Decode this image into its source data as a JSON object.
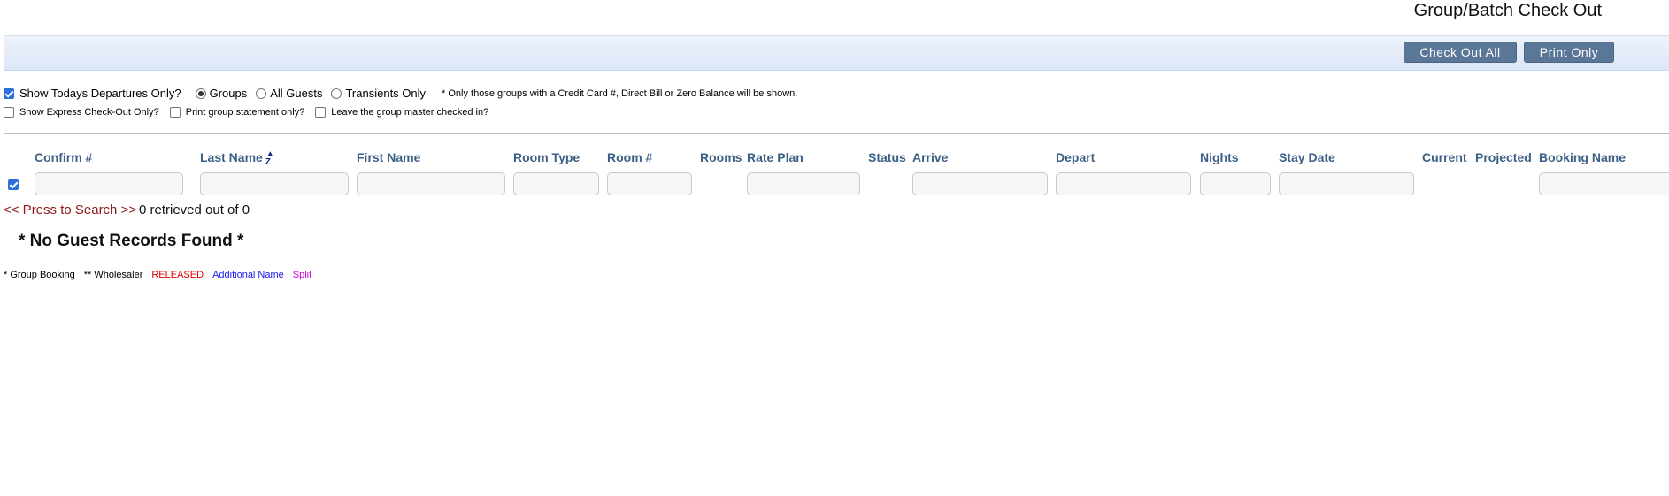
{
  "page": {
    "title": "Group/Batch Check Out"
  },
  "toolbar": {
    "check_out_all": "Check Out All",
    "print_only": "Print Only"
  },
  "options": {
    "todays_departures": {
      "label": "Show Todays Departures Only?",
      "checked": true
    },
    "radio": {
      "groups": "Groups",
      "all_guests": "All Guests",
      "transients": "Transients Only",
      "selected": "Groups"
    },
    "note": "* Only those groups with a Credit Card #, Direct Bill or Zero Balance will be shown.",
    "express_checkout": {
      "label": "Show Express Check-Out Only?",
      "checked": false
    },
    "print_statement": {
      "label": "Print group statement only?",
      "checked": false
    },
    "leave_master": {
      "label": "Leave the group master checked in?",
      "checked": false
    }
  },
  "table": {
    "columns": {
      "confirm": "Confirm #",
      "last_name": "Last Name",
      "first_name": "First Name",
      "room_type": "Room Type",
      "room_no": "Room #",
      "rooms": "Rooms",
      "rate_plan": "Rate Plan",
      "status": "Status",
      "arrive": "Arrive",
      "depart": "Depart",
      "nights": "Nights",
      "stay_date": "Stay Date",
      "current": "Current",
      "projected": "Projected",
      "booking_name": "Booking Name"
    },
    "select_all_checked": true
  },
  "search": {
    "link": "<< Press to Search >>",
    "retrieved": "0 retrieved out of 0"
  },
  "empty_message": "* No Guest Records Found *",
  "legend": {
    "group_booking": "* Group Booking",
    "wholesaler": "** Wholesaler",
    "released": "RELEASED",
    "additional_name": "Additional Name",
    "split": "Split"
  },
  "colors": {
    "header_text": "#3b5f86",
    "button_bg": "#5b7797",
    "released": "#e00000",
    "additional_name": "#1a1aee",
    "split": "#d400d4",
    "search_link": "#8b1a1a"
  }
}
